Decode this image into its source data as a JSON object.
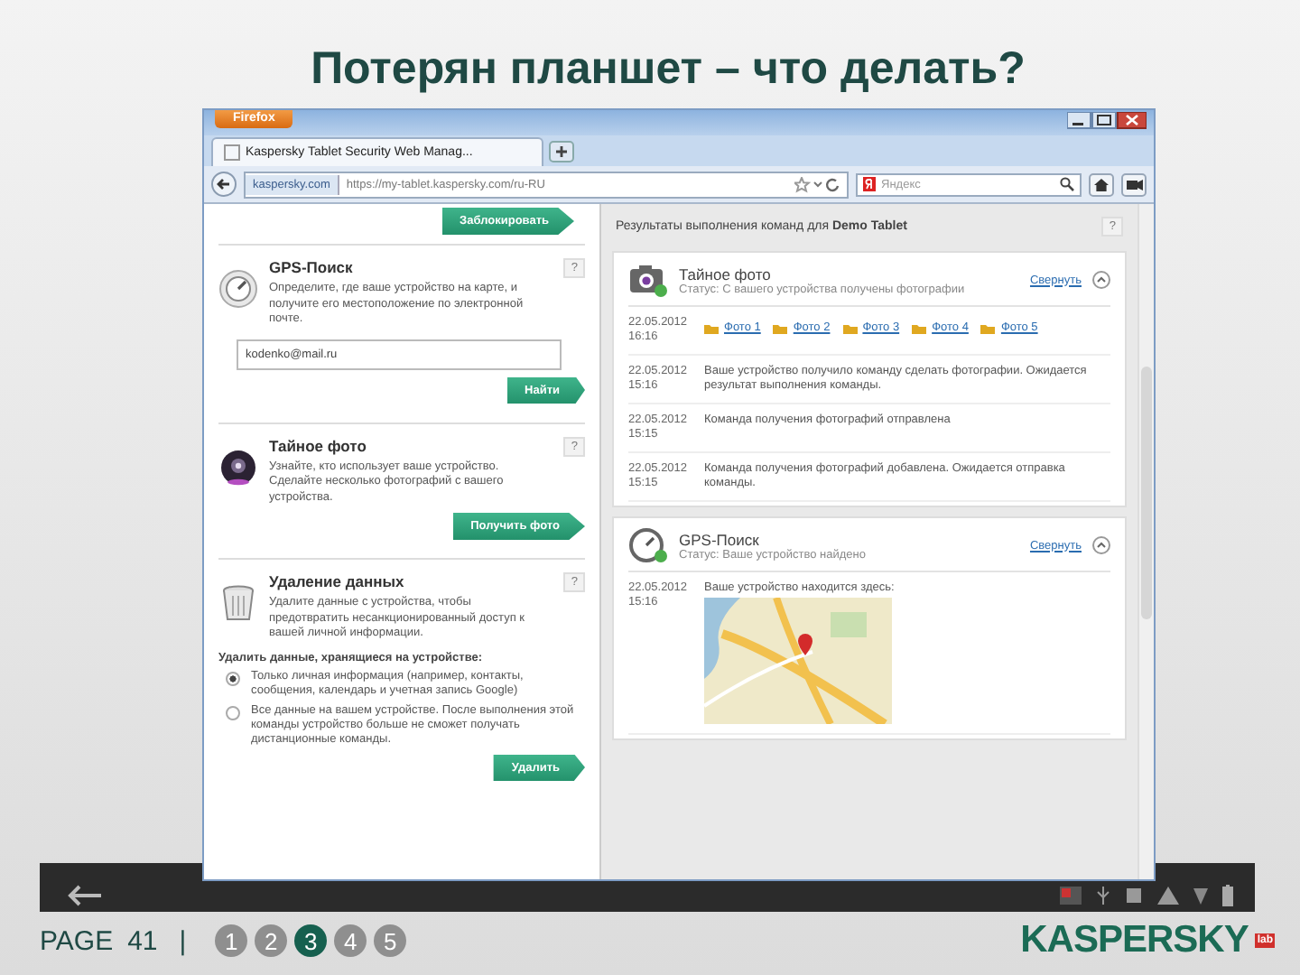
{
  "slide_title": "Потерян планшет – что делать?",
  "browser": {
    "menu_button": "Firefox",
    "tab_title": "Kaspersky Tablet Security Web Manag...",
    "site_badge": "kaspersky.com",
    "url": "https://my-tablet.kaspersky.com/ru-RU",
    "search_placeholder": "Яндекс"
  },
  "left_panel": {
    "top_button": "Заблокировать",
    "sections": [
      {
        "kind": "gps",
        "title": "GPS-Поиск",
        "help": "?",
        "description": "Определите, где ваше устройство на карте, и получите его местоположение по электронной почте.",
        "email": "kodenko@mail.ru",
        "button": "Найти"
      },
      {
        "kind": "photo",
        "title": "Тайное фото",
        "help": "?",
        "description": "Узнайте, кто использует ваше устройство. Сделайте несколько фотографий с вашего устройства.",
        "button": "Получить фото"
      },
      {
        "kind": "wipe",
        "title": "Удаление данных",
        "help": "?",
        "description": "Удалите данные с устройства, чтобы предотвратить несанкционированный доступ к вашей личной информации.",
        "options_label": "Удалить данные, хранящиеся на устройстве:",
        "options": [
          {
            "label": "Только личная информация (например, контакты, сообщения, календарь и учетная запись Google)",
            "selected": true
          },
          {
            "label": "Все данные на вашем устройстве. После выполнения этой команды устройство больше не сможет получать дистанционные команды.",
            "selected": false
          }
        ],
        "button": "Удалить"
      }
    ]
  },
  "results": {
    "heading": "Результаты выполнения команд для **Demo Tablet**",
    "help": "?",
    "cards": [
      {
        "kind": "photo",
        "title": "Тайное фото",
        "status": "Статус: С вашего устройства получены фотографии",
        "collapse": "Свернуть",
        "entries": [
          {
            "date": "22.05.2012",
            "time": "16:16",
            "photos": [
              "Фото 1",
              "Фото 2",
              "Фото 3",
              "Фото 4",
              "Фото 5"
            ]
          },
          {
            "date": "22.05.2012",
            "time": "15:16",
            "text": "Ваше устройство получило команду сделать фотографии. Ожидается результат выполнения команды."
          },
          {
            "date": "22.05.2012",
            "time": "15:15",
            "text": "Команда получения фотографий отправлена"
          },
          {
            "date": "22.05.2012",
            "time": "15:15",
            "text": "Команда получения фотографий добавлена. Ожидается отправка команды."
          }
        ]
      },
      {
        "kind": "gps",
        "title": "GPS-Поиск",
        "status": "Статус: Ваше устройство найдено",
        "collapse": "Свернуть",
        "entries": [
          {
            "date": "22.05.2012",
            "time": "15:16",
            "text": "Ваше устройство находится здесь:",
            "map": true
          }
        ]
      }
    ]
  },
  "footer": {
    "page_label": "PAGE",
    "page_number": "41",
    "separator": "|",
    "pages": [
      {
        "label": "1",
        "selected": false
      },
      {
        "label": "2",
        "selected": false
      },
      {
        "label": "3",
        "selected": true
      },
      {
        "label": "4",
        "selected": false
      },
      {
        "label": "5",
        "selected": false
      }
    ],
    "logo": "KASPERSKY",
    "logo_suffix": "lab"
  }
}
